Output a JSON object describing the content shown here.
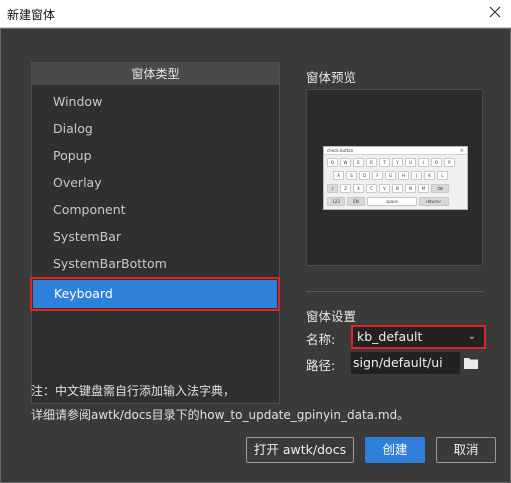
{
  "window": {
    "title": "新建窗体"
  },
  "type_panel": {
    "header": "窗体类型",
    "items": [
      {
        "label": "Window",
        "selected": false
      },
      {
        "label": "Dialog",
        "selected": false
      },
      {
        "label": "Popup",
        "selected": false
      },
      {
        "label": "Overlay",
        "selected": false
      },
      {
        "label": "Component",
        "selected": false
      },
      {
        "label": "SystemBar",
        "selected": false
      },
      {
        "label": "SystemBarBottom",
        "selected": false
      },
      {
        "label": "Keyboard",
        "selected": true
      }
    ]
  },
  "preview": {
    "label": "窗体预览",
    "keyboard": {
      "title": "check button",
      "close": "×",
      "row1": [
        "Q",
        "W",
        "E",
        "R",
        "T",
        "Y",
        "U",
        "I",
        "O",
        "P"
      ],
      "row2": [
        "A",
        "S",
        "D",
        "F",
        "G",
        "H",
        "J",
        "K",
        "L"
      ],
      "row3": [
        "⇧",
        "Z",
        "X",
        "C",
        "V",
        "B",
        "N",
        "M",
        "⌫"
      ],
      "row4": [
        "123",
        "EN",
        "space",
        "return↵"
      ]
    }
  },
  "settings": {
    "label": "窗体设置",
    "name_label": "名称:",
    "name_value": "kb_default",
    "path_label": "路径:",
    "path_value": "sign/default/ui"
  },
  "note": {
    "line1": "注：中文键盘需自行添加输入法字典，",
    "line2": "详细请参阅awtk/docs目录下的how_to_update_gpinyin_data.md。"
  },
  "buttons": {
    "open": "打开 awtk/docs",
    "create": "创建",
    "cancel": "取消"
  },
  "colors": {
    "accent": "#2f80d8",
    "highlight": "#e02424",
    "background": "#3a3a3a"
  }
}
